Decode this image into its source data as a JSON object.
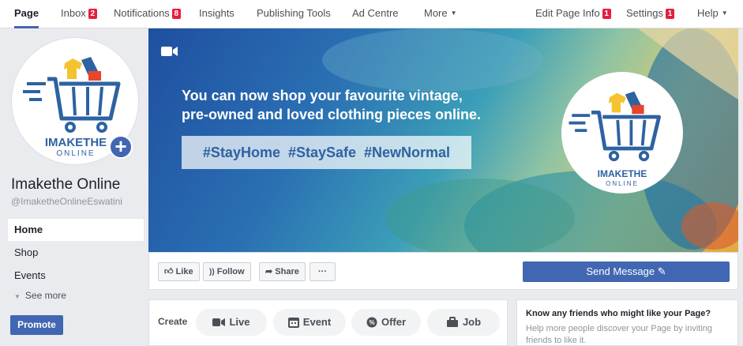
{
  "topnav": {
    "items": [
      {
        "label": "Page",
        "badge": ""
      },
      {
        "label": "Inbox",
        "badge": "2"
      },
      {
        "label": "Notifications",
        "badge": "8"
      },
      {
        "label": "Insights",
        "badge": ""
      },
      {
        "label": "Publishing Tools",
        "badge": ""
      },
      {
        "label": "Ad Centre",
        "badge": ""
      },
      {
        "label": "More",
        "badge": ""
      }
    ],
    "right": [
      {
        "label": "Edit Page Info",
        "badge": "1"
      },
      {
        "label": "Settings",
        "badge": "1"
      },
      {
        "label": "Help",
        "badge": ""
      }
    ]
  },
  "sidebar": {
    "page_name": "Imakethe Online",
    "handle": "@ImaketheOnlineEswatini",
    "logo_line1": "IMAKETHE",
    "logo_line2": "ONLINE",
    "links": [
      "Home",
      "Shop",
      "Events"
    ],
    "see_more": "See more",
    "promote": "Promote"
  },
  "cover": {
    "line1": "You can now shop your favourite vintage,",
    "line2": "pre-owned and loved clothing pieces online.",
    "hashtags": "#StayHome  #StaySafe  #NewNormal",
    "logo_line1": "IMAKETHE",
    "logo_line2": "ONLINE"
  },
  "actions": {
    "like": "Like",
    "follow": "Follow",
    "share": "Share",
    "more": "···",
    "send_message": "Send Message"
  },
  "create": {
    "label": "Create",
    "live": "Live",
    "event": "Event",
    "offer": "Offer",
    "job": "Job"
  },
  "friends": {
    "title": "Know any friends who might like your Page?",
    "subtitle": "Help more people discover your Page by inviting friends to like it."
  },
  "colors": {
    "accent": "#4267b2",
    "badge": "#e41e3f"
  }
}
